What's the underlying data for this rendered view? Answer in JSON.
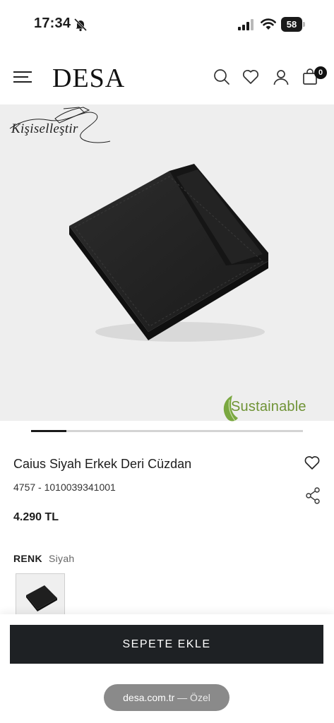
{
  "status_bar": {
    "time": "17:34",
    "battery": "58"
  },
  "header": {
    "logo": "DESA",
    "cart_count": "0"
  },
  "product_image": {
    "personalize_label": "Kişiselleştir",
    "sustainable_label": "Sustainable"
  },
  "carousel": {
    "active_fraction": 0.13
  },
  "product": {
    "title": "Caius Siyah Erkek Deri Cüzdan",
    "code": "4757 -  1010039341001",
    "price": "4.290 TL",
    "color_label": "RENK",
    "color_value": "Siyah"
  },
  "actions": {
    "add_to_cart": "SEPETE EKLE"
  },
  "browser": {
    "domain": "desa.com.tr",
    "mode": " — Özel"
  }
}
